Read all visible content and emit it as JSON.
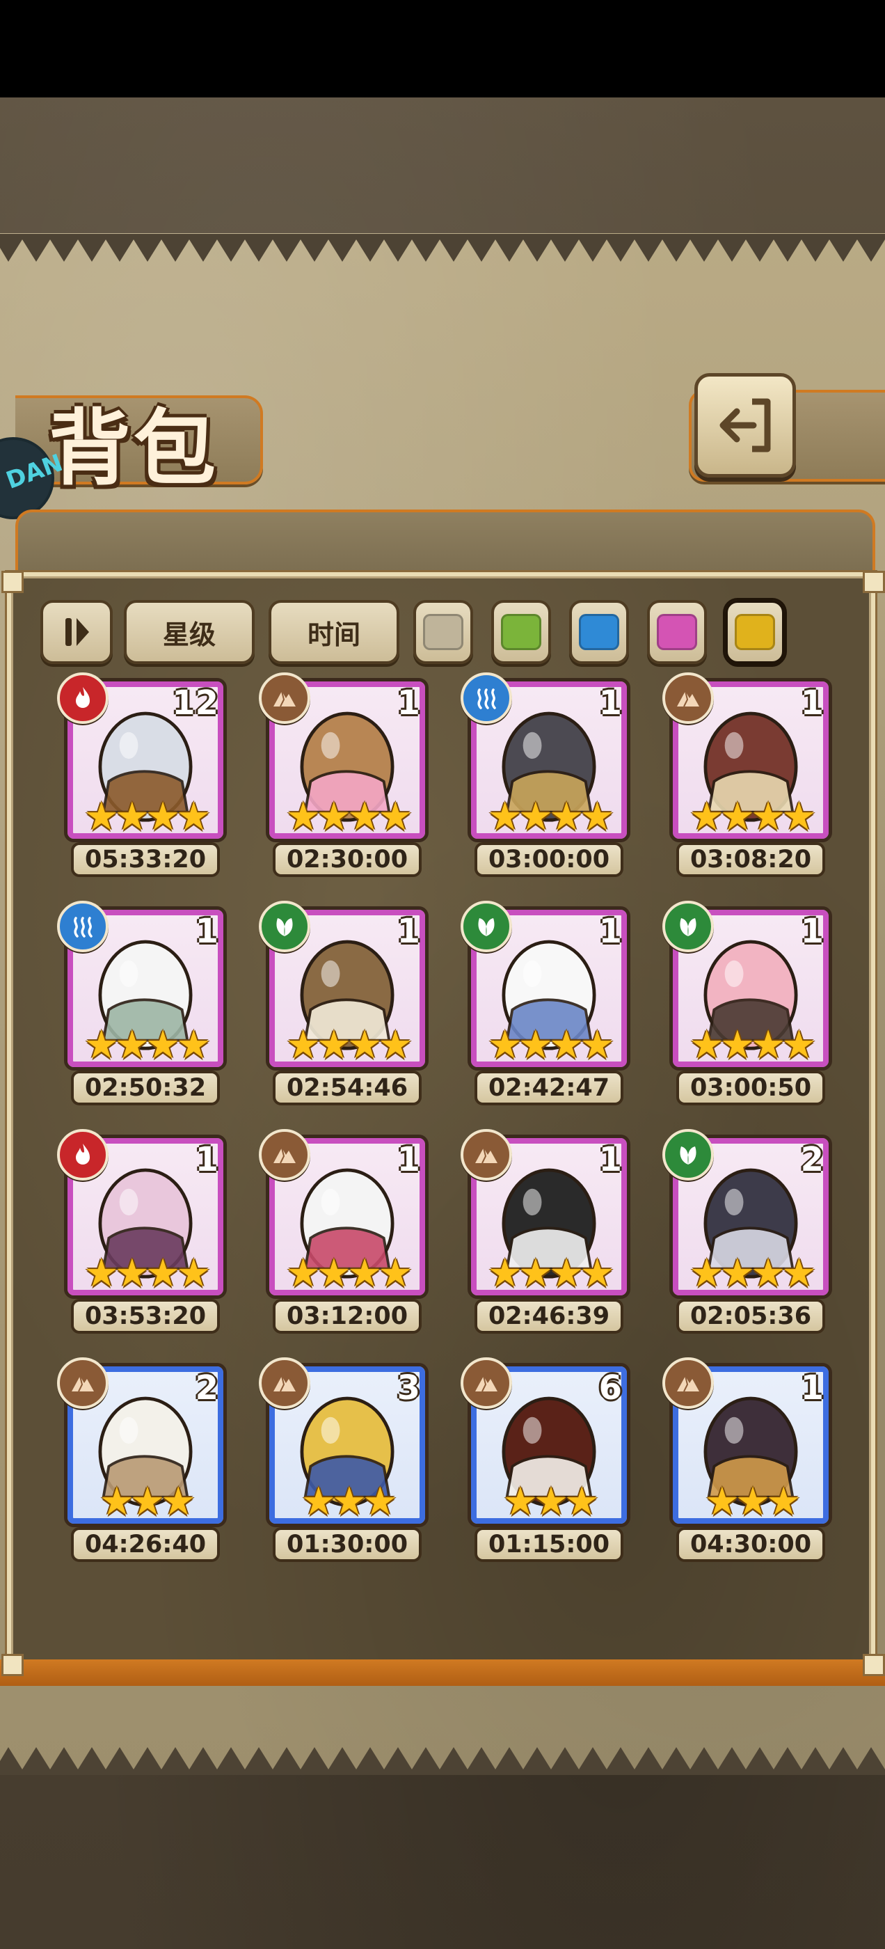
{
  "header": {
    "title": "背包",
    "badge_text": "DAN"
  },
  "filters": {
    "sort_star_label": "星级",
    "sort_time_label": "时间",
    "swatches": [
      "#bfb49a",
      "#7bb43a",
      "#2f8ad6",
      "#d454b4",
      "#e0b21c"
    ]
  },
  "element_icons": {
    "fire": "flame-icon",
    "water": "water-waves-icon",
    "earth": "mountain-icon",
    "grass": "leaf-icon"
  },
  "items": [
    {
      "element": "fire",
      "count": "12",
      "stars": 4,
      "time": "05:33:20",
      "rarity": "purple"
    },
    {
      "element": "earth",
      "count": "1",
      "stars": 4,
      "time": "02:30:00",
      "rarity": "purple"
    },
    {
      "element": "water",
      "count": "1",
      "stars": 4,
      "time": "03:00:00",
      "rarity": "purple"
    },
    {
      "element": "earth",
      "count": "1",
      "stars": 4,
      "time": "03:08:20",
      "rarity": "purple"
    },
    {
      "element": "water",
      "count": "1",
      "stars": 4,
      "time": "02:50:32",
      "rarity": "purple"
    },
    {
      "element": "grass",
      "count": "1",
      "stars": 4,
      "time": "02:54:46",
      "rarity": "purple"
    },
    {
      "element": "grass",
      "count": "1",
      "stars": 4,
      "time": "02:42:47",
      "rarity": "purple"
    },
    {
      "element": "grass",
      "count": "1",
      "stars": 4,
      "time": "03:00:50",
      "rarity": "purple"
    },
    {
      "element": "fire",
      "count": "1",
      "stars": 4,
      "time": "03:53:20",
      "rarity": "purple"
    },
    {
      "element": "earth",
      "count": "1",
      "stars": 4,
      "time": "03:12:00",
      "rarity": "purple"
    },
    {
      "element": "earth",
      "count": "1",
      "stars": 4,
      "time": "02:46:39",
      "rarity": "purple"
    },
    {
      "element": "grass",
      "count": "2",
      "stars": 4,
      "time": "02:05:36",
      "rarity": "purple"
    },
    {
      "element": "earth",
      "count": "2",
      "stars": 3,
      "time": "04:26:40",
      "rarity": "blue"
    },
    {
      "element": "earth",
      "count": "3",
      "stars": 3,
      "time": "01:30:00",
      "rarity": "blue"
    },
    {
      "element": "earth",
      "count": "6",
      "stars": 3,
      "time": "01:15:00",
      "rarity": "blue"
    },
    {
      "element": "earth",
      "count": "1",
      "stars": 3,
      "time": "04:30:00",
      "rarity": "blue"
    }
  ]
}
